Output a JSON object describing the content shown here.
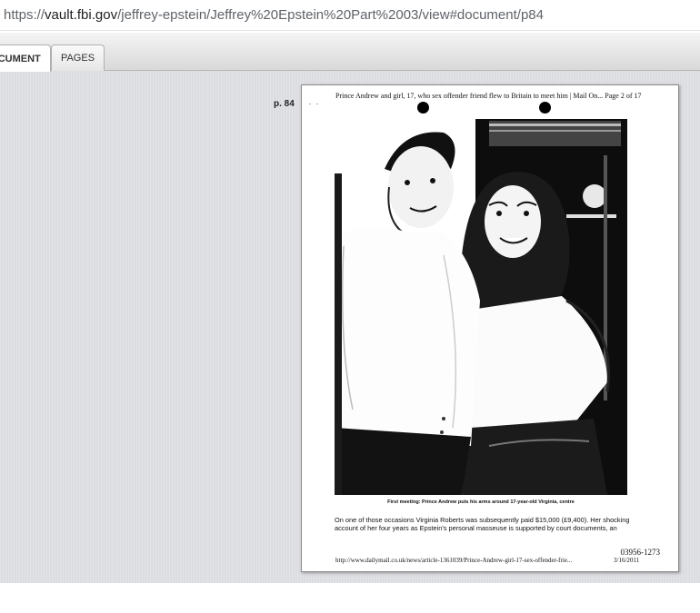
{
  "browser": {
    "url_prefix": "https://",
    "url_host": "vault.fbi.gov",
    "url_path": "/jeffrey-epstein/Jeffrey%20Epstein%20Part%2003/view#document/p84"
  },
  "tabs": [
    {
      "label": "Document",
      "active": true
    },
    {
      "label": "Pages",
      "active": false
    }
  ],
  "viewer": {
    "page_label": "p. 84"
  },
  "document": {
    "header": "Prince Andrew and girl, 17, who sex offender friend flew to Britain to meet him | Mail On... Page 2 of 17",
    "margin_marks": ". .",
    "caption": "First meeting: Prince Andrew puts his arms around 17-year-old Virginia, centre",
    "body_line_1": "On one of those occasions Virginia Roberts was subsequently paid $15,000 (£9,400). Her shocking",
    "body_line_2": "account of her four years as Epstein's personal masseuse is supported by court documents, an",
    "doc_id": "03956-1273",
    "footer_url": "http://www.dailymail.co.uk/news/article-1361039/Prince-Andrew-girl-17-sex-offender-frie...",
    "footer_date": "3/16/2011"
  },
  "colors": {
    "viewer_bg": "#dcdde0",
    "tab_active_bg": "#ffffff"
  }
}
